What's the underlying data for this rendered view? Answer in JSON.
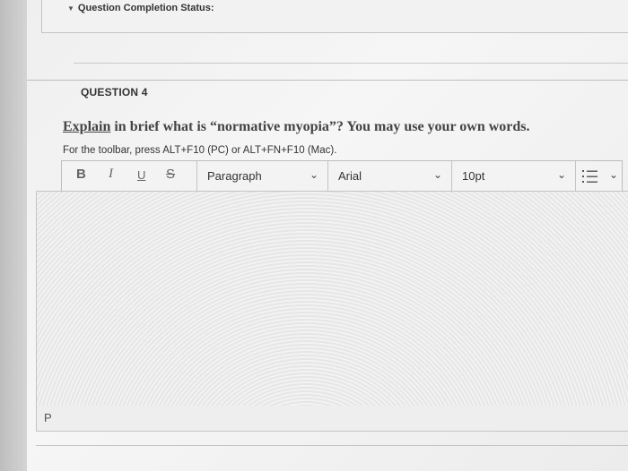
{
  "question_completion_status": {
    "label": "Question Completion Status:"
  },
  "question": {
    "number_label": "QUESTION 4",
    "text_underlined": "Explain",
    "text_rest": " in brief what is “normative myopia”? You may use your own words."
  },
  "editor": {
    "toolbar_hint": "For the toolbar, press ALT+F10 (PC) or ALT+FN+F10 (Mac).",
    "bold_label": "B",
    "italic_label": "I",
    "underline_label": "U",
    "strike_label": "S",
    "paragraph_format": "Paragraph",
    "font_family": "Arial",
    "font_size": "10pt",
    "list_icon": "list-icon",
    "path_label": "P",
    "content": ""
  }
}
